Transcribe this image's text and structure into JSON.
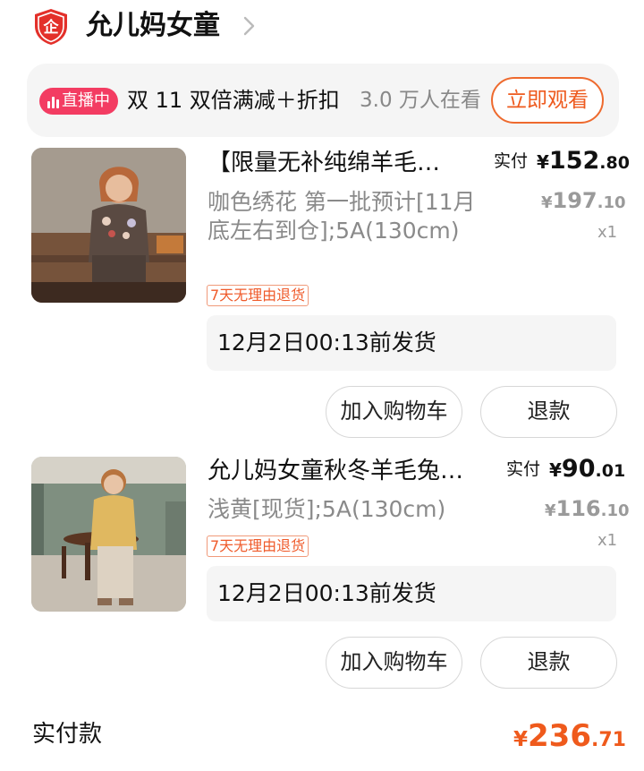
{
  "shop": {
    "name": "允儿妈女童",
    "logo_icon": "shop-badge-icon",
    "logo_glyph": "企",
    "chevron_icon": "chevron-right-icon"
  },
  "live": {
    "badge": "直播中",
    "badge_icon": "live-bars-icon",
    "title": "双 11 双倍满减＋折扣",
    "viewers": "3.0 万人在看",
    "watch_button": "立即观看",
    "accent_color": "#f33c62"
  },
  "products": [
    {
      "title": "【限量无补纯绵羊毛…",
      "specs": "咖色绣花 第一批预计[11月底左右到仓];5A(130cm)",
      "pay_label": "实付",
      "pay_currency": "¥",
      "pay_int": "152",
      "pay_dec": ".80",
      "orig_currency": "¥",
      "orig_int": "197",
      "orig_dec": ".10",
      "qty": "x1",
      "return_tag": "7天无理由退货",
      "ship": "12月2日00:13前发货",
      "cart_button": "加入购物车",
      "refund_button": "退款"
    },
    {
      "title": "允儿妈女童秋冬羊毛兔…",
      "specs": "浅黄[现货];5A(130cm)",
      "pay_label": "实付",
      "pay_currency": "¥",
      "pay_int": "90",
      "pay_dec": ".01",
      "orig_currency": "¥",
      "orig_int": "116",
      "orig_dec": ".10",
      "qty": "x1",
      "return_tag": "7天无理由退货",
      "ship": "12月2日00:13前发货",
      "cart_button": "加入购物车",
      "refund_button": "退款"
    }
  ],
  "total": {
    "label": "实付款",
    "currency": "¥",
    "int": "236",
    "dec": ".71",
    "color": "#ef5a1c"
  }
}
